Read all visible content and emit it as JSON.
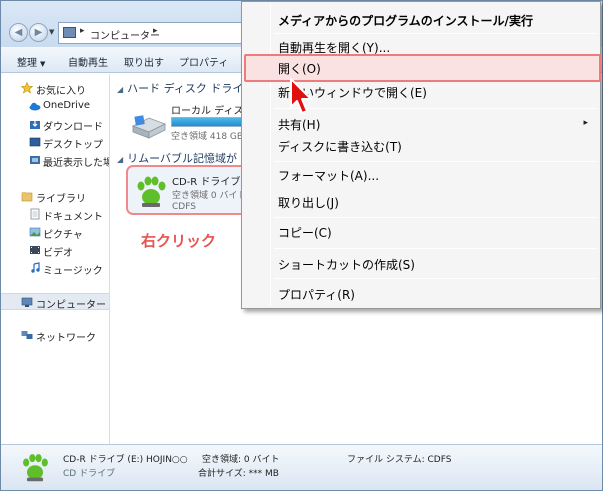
{
  "address": {
    "path_label": "コンピューター",
    "sep1": "▸",
    "sep2": "▸"
  },
  "toolbar": {
    "organize": "整理",
    "autoplay": "自動再生",
    "eject": "取り出す",
    "properties": "プロパティ"
  },
  "nav": {
    "favorites": "お気に入り",
    "onedrive": "OneDrive",
    "downloads": "ダウンロード",
    "desktop": "デスクトップ",
    "recent": "最近表示した場所",
    "libraries": "ライブラリ",
    "documents": "ドキュメント",
    "pictures": "ピクチャ",
    "videos": "ビデオ",
    "music": "ミュージック",
    "computer": "コンピューター",
    "network": "ネットワーク"
  },
  "main": {
    "hdd_group": "ハード ディスク ドライ",
    "hdd_name": "ローカル ディスク",
    "hdd_free": "空き領域 418 GB/",
    "hdd_used_fraction": 0.55,
    "removable_group": "リムーバブル記憶域が",
    "cd_name": "CD-R ドライブ (",
    "cd_free": "空き領域 0 バイト",
    "cd_fs": "CDFS",
    "annotation": "右クリック"
  },
  "context_menu": {
    "items": [
      {
        "label": "メディアからのプログラムのインストール/実行",
        "bold": true
      },
      {
        "label": "自動再生を開く(Y)..."
      },
      {
        "label": "開く(O)",
        "highlighted": true
      },
      {
        "label": "新しいウィンドウで開く(E)"
      },
      {
        "label": "共有(H)",
        "submenu": true
      },
      {
        "label": "ディスクに書き込む(T)"
      },
      {
        "label": "フォーマット(A)..."
      },
      {
        "label": "取り出し(J)"
      },
      {
        "label": "コピー(C)"
      },
      {
        "label": "ショートカットの作成(S)"
      },
      {
        "label": "プロパティ(R)"
      }
    ],
    "submenu_arrow": "▸"
  },
  "details": {
    "title": "CD-R  ドライブ (E:) HOJIN○○",
    "type": "CD ドライブ",
    "free_label": "空き領域: 0 バイト",
    "total_label": "合計サイズ: *** MB",
    "fs_label": "ファイル システム: CDFS"
  },
  "colors": {
    "highlight_border": "#ee7b7b",
    "annotation": "#e8534f",
    "cursor": "#e01010",
    "cd_icon": "#5fbf2a"
  }
}
